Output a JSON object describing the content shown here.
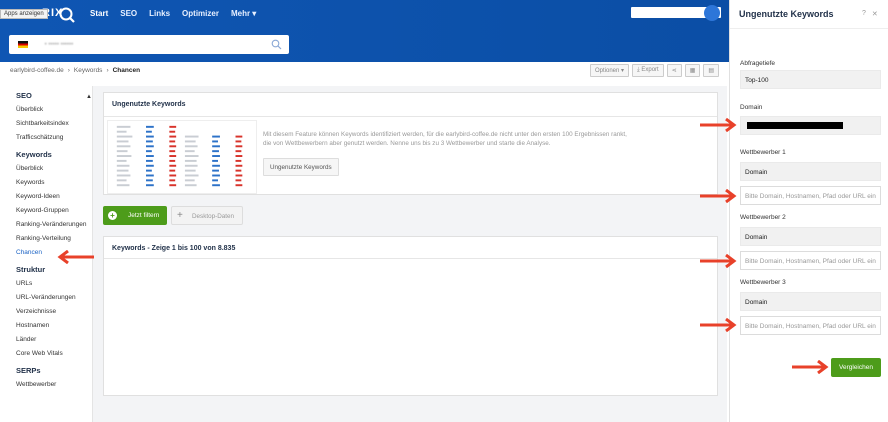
{
  "tooltip": "Apps anzeigen",
  "logo": "RIX",
  "nav": {
    "start": "Start",
    "seo": "SEO",
    "links": "Links",
    "optimizer": "Optimizer",
    "mehr": "Mehr ▾"
  },
  "breadcrumb": {
    "domain": "earlybird-coffee.de",
    "keywords": "Keywords",
    "current": "Chancen"
  },
  "toolbar": {
    "optionen": "Optionen",
    "export": "Export"
  },
  "sidebar": {
    "seo": {
      "title": "SEO",
      "items": [
        "Überblick",
        "Sichtbarkeitsindex",
        "Trafficschätzung"
      ]
    },
    "keywords": {
      "title": "Keywords",
      "items": [
        "Überblick",
        "Keywords",
        "Keyword-Ideen",
        "Keyword-Gruppen",
        "Ranking-Veränderungen",
        "Ranking-Verteilung",
        "Chancen"
      ]
    },
    "struktur": {
      "title": "Struktur",
      "items": [
        "URLs",
        "URL-Veränderungen",
        "Verzeichnisse",
        "Hostnamen",
        "Länder",
        "Core Web Vitals"
      ]
    },
    "serps": {
      "title": "SERPs",
      "items": [
        "Wettbewerber"
      ]
    }
  },
  "feature_card": {
    "title": "Ungenutzte Keywords",
    "text": "Mit diesem Feature können Keywords identifiziert werden, für die earlybird-coffee.de nicht unter den ersten 100 Ergebnissen rankt, die von Wettbewerbern aber genutzt werden. Nenne uns bis zu 3 Wettbewerber und starte die Analyse.",
    "button": "Ungenutzte Keywords"
  },
  "actions": {
    "filter": "Jetzt filtern",
    "desktop": "Desktop-Daten"
  },
  "keywords_card": {
    "title": "Keywords - Zeige 1 bis 100 von 8.835"
  },
  "panel": {
    "title": "Ungenutzte Keywords",
    "help": "?",
    "close": "✕",
    "abfragetiefe_label": "Abfragetiefe",
    "abfragetiefe_value": "Top-100",
    "domain_label": "Domain",
    "competitors": [
      {
        "label": "Wettbewerber 1",
        "type": "Domain",
        "placeholder": "Bitte Domain, Hostnamen, Pfad oder URL ein"
      },
      {
        "label": "Wettbewerber 2",
        "type": "Domain",
        "placeholder": "Bitte Domain, Hostnamen, Pfad oder URL ein"
      },
      {
        "label": "Wettbewerber 3",
        "type": "Domain",
        "placeholder": "Bitte Domain, Hostnamen, Pfad oder URL ein"
      }
    ],
    "compare_button": "Vergleichen"
  },
  "colors": {
    "topbar": "#0f56b3",
    "green": "#4d9c1a",
    "arrow": "#e8412a",
    "link": "#1a62c4"
  }
}
